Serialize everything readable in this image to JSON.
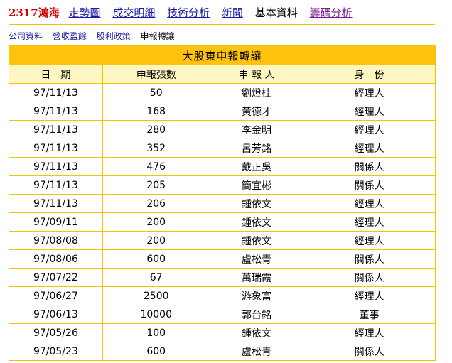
{
  "header": {
    "stock_label": "2317鴻海",
    "nav": [
      {
        "label": "走勢圖"
      },
      {
        "label": "成交明細"
      },
      {
        "label": "技術分析"
      },
      {
        "label": "新聞"
      },
      {
        "label": "基本資料"
      },
      {
        "label": "籌碼分析"
      }
    ]
  },
  "subnav": [
    {
      "label": "公司資料"
    },
    {
      "label": "營收盈餘"
    },
    {
      "label": "股利政策"
    },
    {
      "label": "申報轉讓"
    }
  ],
  "table": {
    "title": "大股東申報轉讓",
    "headers": [
      "日　期",
      "申報張數",
      "申 報 人",
      "身　份"
    ],
    "rows": [
      [
        "97/11/13",
        "50",
        "劉燈桂",
        "經理人"
      ],
      [
        "97/11/13",
        "168",
        "黃德才",
        "經理人"
      ],
      [
        "97/11/13",
        "280",
        "李金明",
        "經理人"
      ],
      [
        "97/11/13",
        "352",
        "呂芳銘",
        "經理人"
      ],
      [
        "97/11/13",
        "476",
        "戴正吳",
        "關係人"
      ],
      [
        "97/11/13",
        "205",
        "簡宜彬",
        "關係人"
      ],
      [
        "97/11/13",
        "206",
        "鍾依文",
        "經理人"
      ],
      [
        "97/09/11",
        "200",
        "鍾依文",
        "經理人"
      ],
      [
        "97/08/08",
        "200",
        "鍾依文",
        "經理人"
      ],
      [
        "97/08/06",
        "600",
        "盧松青",
        "關係人"
      ],
      [
        "97/07/22",
        "67",
        "萬瑞霞",
        "關係人"
      ],
      [
        "97/06/27",
        "2500",
        "游象富",
        "經理人"
      ],
      [
        "97/06/13",
        "10000",
        "郭台銘",
        "董事"
      ],
      [
        "97/05/26",
        "100",
        "鍾依文",
        "經理人"
      ],
      [
        "97/05/23",
        "600",
        "盧松青",
        "關係人"
      ]
    ]
  }
}
